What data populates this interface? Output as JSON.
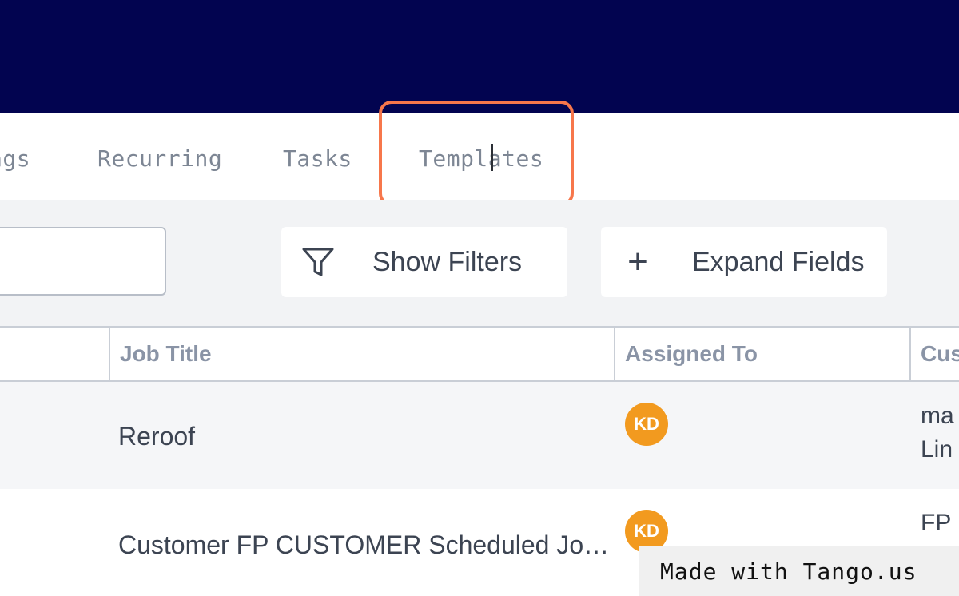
{
  "tabs": {
    "items": [
      {
        "label": "ags"
      },
      {
        "label": "Recurring"
      },
      {
        "label": "Tasks"
      },
      {
        "label": "Templates"
      }
    ]
  },
  "toolbar": {
    "search": {
      "value": "",
      "placeholder": ""
    },
    "show_filters_label": "Show Filters",
    "show_filters_icon": "filter-icon",
    "expand_fields_label": "Expand Fields",
    "expand_fields_icon": "plus-icon",
    "expand_fields_glyph": "+"
  },
  "table": {
    "columns": [
      "Job Title",
      "Assigned To",
      "Cust"
    ],
    "rows": [
      {
        "job_title": "Reroof",
        "assigned_initials": "KD",
        "customer": [
          "ma",
          "Lin"
        ]
      },
      {
        "job_title": "Customer FP CUSTOMER Scheduled Jo…",
        "assigned_initials": "KD",
        "customer": [
          "FP"
        ]
      }
    ]
  },
  "watermark": {
    "text": "Made with Tango.us"
  },
  "colors": {
    "header_bg": "#020450",
    "highlight": "#f7774b",
    "avatar": "#f29a1f",
    "text": "#3c4452",
    "muted": "#8a94a6"
  }
}
